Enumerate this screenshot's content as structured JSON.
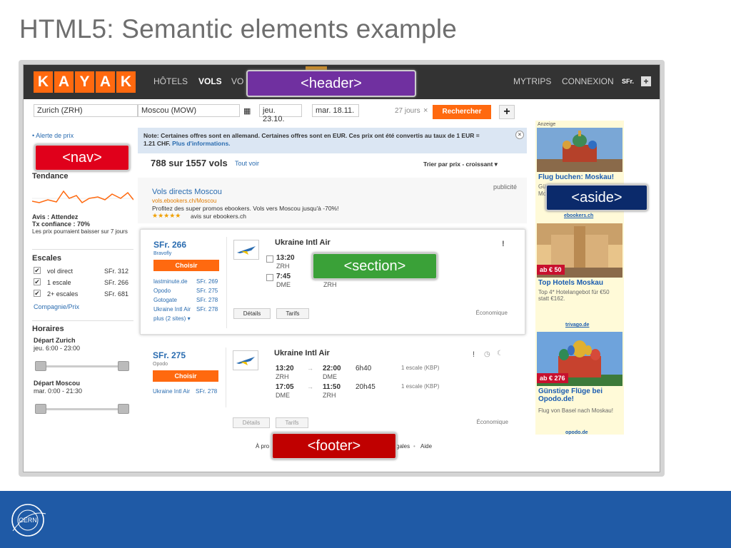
{
  "slide": {
    "title": "HTML5: Semantic elements example"
  },
  "kayak": {
    "logo_letters": [
      "K",
      "A",
      "Y",
      "A",
      "K"
    ],
    "nav": {
      "hotels": "HÔTELS",
      "flights": "VOLS",
      "more": "VO",
      "mytrips": "MYTRIPS",
      "login": "CONNEXION",
      "currency": "SFr."
    },
    "search": {
      "from": "Zurich (ZRH)",
      "to": "Moscou (MOW)",
      "depart": "jeu. 23.10.",
      "return": "mar. 18.11.",
      "duration": "27 jours",
      "clear": "×",
      "button": "Rechercher",
      "add": "+"
    }
  },
  "nav_col": {
    "price_alert": "• Alerte de prix",
    "trend_title": "Tendance",
    "advice": "Avis : Attendez",
    "confidence": "Tx confiance : 70%",
    "prediction": "Les prix pourraient baisser sur 7 jours",
    "stops_title": "Escales",
    "stops": [
      {
        "label": "vol direct",
        "price": "SFr. 312"
      },
      {
        "label": "1 escale",
        "price": "SFr. 266"
      },
      {
        "label": "2+ escales",
        "price": "SFr. 681"
      }
    ],
    "airline_price": "Compagnie/Prix",
    "times_title": "Horaires",
    "dep_zurich": "Départ Zurich",
    "dep_zurich_range": "jeu. 6:00 - 23:00",
    "dep_moscow": "Départ Moscou",
    "dep_moscow_range": "mar. 0:00 - 21:30"
  },
  "main": {
    "notice": "Note: Certaines offres sont en allemand. Certaines offres sont en EUR. Ces prix ont été convertis au taux de 1 EUR =",
    "notice2": "1.21 CHF.",
    "notice_link": "Plus d'informations.",
    "notice_close": "×",
    "count": "788 sur 1557 vols",
    "see_all": "Tout voir",
    "sort": "Trier par prix - croissant ▾",
    "ad": {
      "title": "Vols directs Moscou",
      "url": "vols.ebookers.ch/Moscou",
      "text": "Profitez des super promos ebookers. Vols vers Moscou jusqu'à -70%!",
      "stars": "★★★★★",
      "reviews": "avis sur ebookers.ch",
      "tag": "publicité"
    },
    "results": [
      {
        "price": "SFr. 266",
        "provider": "Bravofly",
        "choose": "Choisir",
        "airline": "Ukraine Intl Air",
        "flag": "!",
        "others": [
          {
            "name": "lastminute.de",
            "price": "SFr. 269"
          },
          {
            "name": "Opodo",
            "price": "SFr. 275"
          },
          {
            "name": "Gotogate",
            "price": "SFr. 278"
          },
          {
            "name": "Ukraine Intl Air",
            "price": "SFr. 278"
          }
        ],
        "more": "plus (2 sites) ▾",
        "out": {
          "dep": "13:20",
          "from": "ZRH"
        },
        "back": {
          "dep": "7:45",
          "from": "DME",
          "to": "ZRH"
        },
        "details": "Détails",
        "fares": "Tarifs",
        "cabin": "Économique"
      },
      {
        "price": "SFr. 275",
        "provider": "Opodo",
        "choose": "Choisir",
        "airline": "Ukraine Intl Air",
        "flag": "!",
        "others": [
          {
            "name": "Ukraine Intl Air",
            "price": "SFr. 278"
          }
        ],
        "out": {
          "dep": "13:20",
          "arr": "22:00",
          "from": "ZRH",
          "to": "DME",
          "dur": "6h40",
          "stops": "1 escale (KBP)"
        },
        "back": {
          "dep": "17:05",
          "arr": "11:50",
          "from": "DME",
          "to": "ZRH",
          "dur": "20h45",
          "stops": "1 escale (KBP)"
        },
        "arrow": "→",
        "details": "Détails",
        "fares": "Tarifs",
        "cabin": "Économique"
      }
    ]
  },
  "ads": {
    "label": "Anzeige",
    "a1": {
      "title": "Flug buchen: Moskau!",
      "text1": "Gü",
      "text2": "Mo",
      "link": "ebookers.ch"
    },
    "a2": {
      "badge": "ab € 50",
      "title": "Top Hotels Moskau",
      "text": "Top 4* Hotelangebot für €50 statt €162.",
      "link": "trivago.de"
    },
    "a3": {
      "badge": "ab € 276",
      "title": "Günstige Flüge bei Opodo.de!",
      "text": "Flug von Basel nach Moskau!",
      "link": "opodo.de"
    }
  },
  "footer": {
    "left": "À pro",
    "right": "gales",
    "dot": "•",
    "help": "Aide"
  },
  "tags": {
    "header": "<header>",
    "nav": "<nav>",
    "aside": "<aside>",
    "section": "<section>",
    "footer": "<footer>"
  },
  "brand": {
    "cern": "CERN"
  }
}
